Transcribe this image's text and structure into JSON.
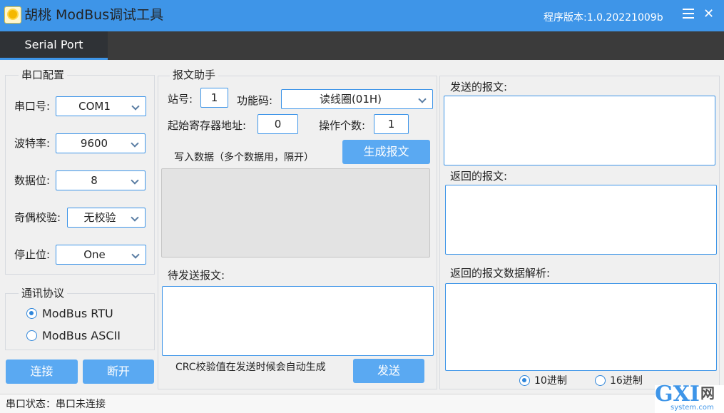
{
  "titlebar": {
    "title": "胡桃 ModBus调试工具",
    "version": "程序版本:1.0.20221009b",
    "close": "✕"
  },
  "tabs": [
    {
      "label": "Serial Port",
      "active": true
    }
  ],
  "serial_config": {
    "group_label": "串口配置",
    "port_label": "串口号:",
    "port_value": "COM1",
    "baud_label": "波特率:",
    "baud_value": "9600",
    "databits_label": "数据位:",
    "databits_value": "8",
    "parity_label": "奇偶校验:",
    "parity_value": "无校验",
    "stopbits_label": "停止位:",
    "stopbits_value": "One"
  },
  "protocol": {
    "group_label": "通讯协议",
    "options": [
      {
        "label": "ModBus RTU",
        "selected": true
      },
      {
        "label": "ModBus ASCII",
        "selected": false
      }
    ]
  },
  "connect_buttons": {
    "connect": "连接",
    "disconnect": "断开"
  },
  "helper": {
    "group_label": "报文助手",
    "station_label": "站号:",
    "station_value": "1",
    "function_label": "功能码:",
    "function_value": "读线圈(01H)",
    "start_addr_label": "起始寄存器地址:",
    "start_addr_value": "0",
    "count_label": "操作个数:",
    "count_value": "1",
    "generate_button": "生成报文",
    "write_data_label": "写入数据（多个数据用，隔开）",
    "pending_label": "待发送报文:",
    "crc_note": "CRC校验值在发送时候会自动生成",
    "send_button": "发送"
  },
  "messages": {
    "sent_label": "发送的报文:",
    "returned_label": "返回的报文:",
    "parsed_label": "返回的报文数据解析:",
    "radix_options": [
      {
        "label": "10进制",
        "selected": true
      },
      {
        "label": "16进制",
        "selected": false
      }
    ]
  },
  "status": {
    "text": "串口状态：串口未连接"
  },
  "watermark": {
    "gx": "GXI",
    "net": "网",
    "site": "system.com"
  },
  "colors": {
    "accent": "#3e95e8",
    "button": "#5aa9f2",
    "tabbar": "#3b3b3b"
  }
}
